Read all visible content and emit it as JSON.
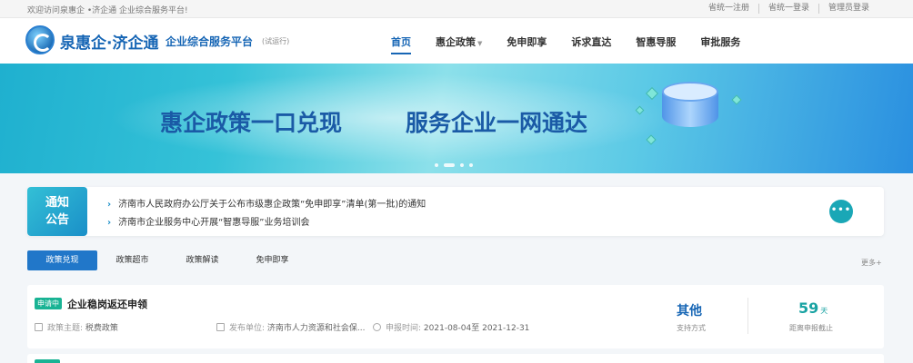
{
  "topbar": {
    "welcome": "欢迎访问泉惠企 •济企通 企业综合服务平台!",
    "links": [
      "省统一注册",
      "省统一登录",
      "管理员登录"
    ]
  },
  "header": {
    "brand": "泉惠企·济企通",
    "subtitle": "企业综合服务平台",
    "trial": "(试运行)",
    "nav": [
      {
        "label": "首页",
        "active": true
      },
      {
        "label": "惠企政策",
        "active": false,
        "caret": "▼"
      },
      {
        "label": "免申即享",
        "active": false
      },
      {
        "label": "诉求直达",
        "active": false
      },
      {
        "label": "智惠导服",
        "active": false
      },
      {
        "label": "审批服务",
        "active": false
      }
    ]
  },
  "banner": {
    "slogan_left": "惠企政策一口兑现",
    "slogan_right": "服务企业一网通达",
    "slide_count": 4,
    "active_slide": 2
  },
  "notice": {
    "tag_line1": "通知",
    "tag_line2": "公告",
    "items": [
      "济南市人民政府办公厅关于公布市级惠企政策“免申即享”清单(第一批)的通知",
      "济南市企业服务中心开展“智惠导服”业务培训会"
    ],
    "arrow": "›",
    "more_icon": "•••"
  },
  "tabs": [
    "政策兑现",
    "政策超市",
    "政策解读",
    "免申即享"
  ],
  "more_link": "更多+",
  "policy": {
    "status": "申请中",
    "title": "企业稳岗返还申领",
    "topic_label": "政策主题:",
    "topic": "税费政策",
    "publisher_label": "发布单位:",
    "publisher": "济南市人力资源和社会保...",
    "period_label": "申报时间:",
    "period": "2021-08-04至 2021-12-31",
    "support": "其他",
    "support_label": "支持方式",
    "days": "59",
    "days_unit": "天",
    "days_label": "距离申报截止"
  },
  "colors": {
    "brand": "#1766b5",
    "accent": "#1aa7b6",
    "status": "#19b394"
  }
}
